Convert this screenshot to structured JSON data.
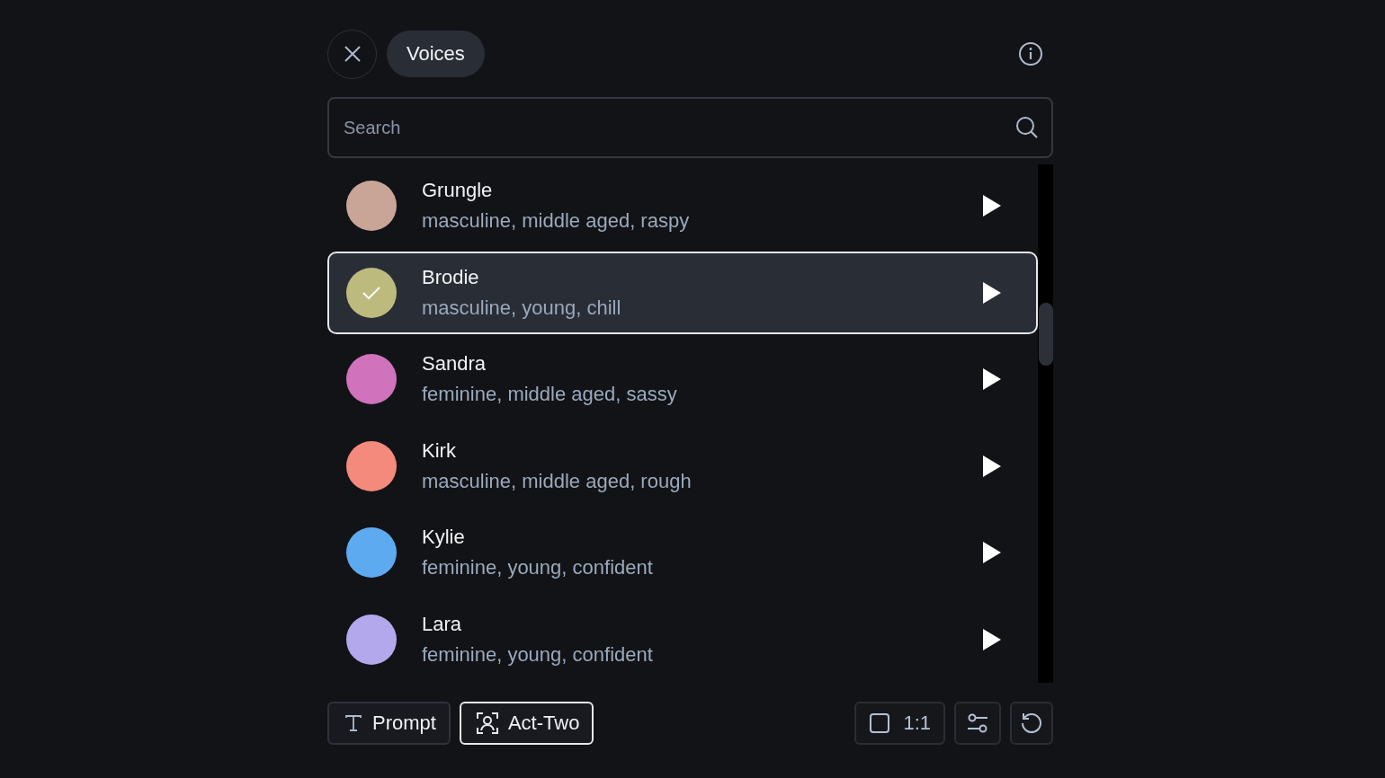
{
  "header": {
    "title": "Voices"
  },
  "search": {
    "placeholder": "Search"
  },
  "voices": [
    {
      "name": "Grungle",
      "description": "masculine, middle aged, raspy",
      "color": "#c8a596",
      "selected": false
    },
    {
      "name": "Brodie",
      "description": "masculine, young, chill",
      "color": "#bcba7c",
      "selected": true
    },
    {
      "name": "Sandra",
      "description": "feminine, middle aged, sassy",
      "color": "#d072bc",
      "selected": false
    },
    {
      "name": "Kirk",
      "description": "masculine, middle aged, rough",
      "color": "#f38a7b",
      "selected": false
    },
    {
      "name": "Kylie",
      "description": "feminine, young, confident",
      "color": "#5eaaf0",
      "selected": false
    },
    {
      "name": "Lara",
      "description": "feminine, young, confident",
      "color": "#b4a8ec",
      "selected": false
    }
  ],
  "modes": [
    {
      "label": "Prompt",
      "kind": "text",
      "selected": false
    },
    {
      "label": "Act-Two",
      "kind": "face",
      "selected": true
    }
  ],
  "aspect_ratio": {
    "label": "1:1"
  }
}
